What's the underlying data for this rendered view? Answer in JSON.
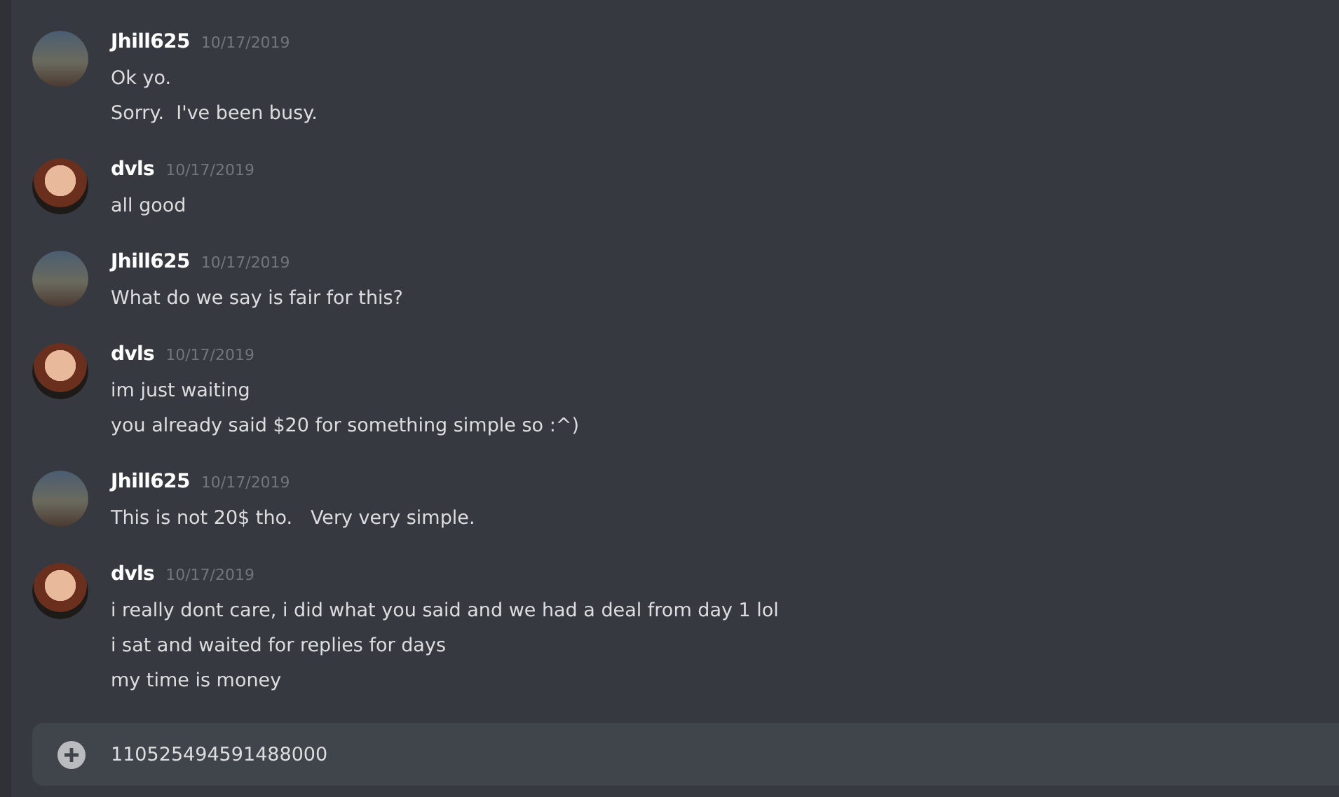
{
  "messages": [
    {
      "author": "Jhill625",
      "timestamp": "10/17/2019",
      "kind": "art",
      "lines": [
        "Ok yo.",
        "Sorry.  I've been busy."
      ]
    },
    {
      "author": "dvls",
      "timestamp": "10/17/2019",
      "kind": "character",
      "lines": [
        "all good"
      ]
    },
    {
      "author": "Jhill625",
      "timestamp": "10/17/2019",
      "kind": "art",
      "lines": [
        "What do we say is fair for this?"
      ]
    },
    {
      "author": "dvls",
      "timestamp": "10/17/2019",
      "kind": "character",
      "lines": [
        "im just waiting",
        "you already said $20 for something simple so :^)"
      ]
    },
    {
      "author": "Jhill625",
      "timestamp": "10/17/2019",
      "kind": "art",
      "lines": [
        "This is not 20$ tho.   Very very simple."
      ]
    },
    {
      "author": "dvls",
      "timestamp": "10/17/2019",
      "kind": "character",
      "lines": [
        "i really dont care, i did what you said and we had a deal from day 1 lol",
        "i sat and waited for replies for days",
        "my time is money"
      ]
    }
  ],
  "composer": {
    "value": "110525494591488000"
  }
}
